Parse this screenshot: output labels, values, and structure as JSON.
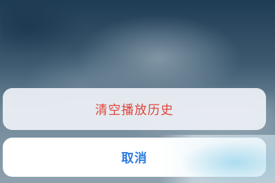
{
  "action_sheet": {
    "clear_history_label": "清空播放历史",
    "cancel_label": "取消"
  },
  "colors": {
    "destructive": "#e0453a",
    "cancel": "#2d7be0"
  }
}
